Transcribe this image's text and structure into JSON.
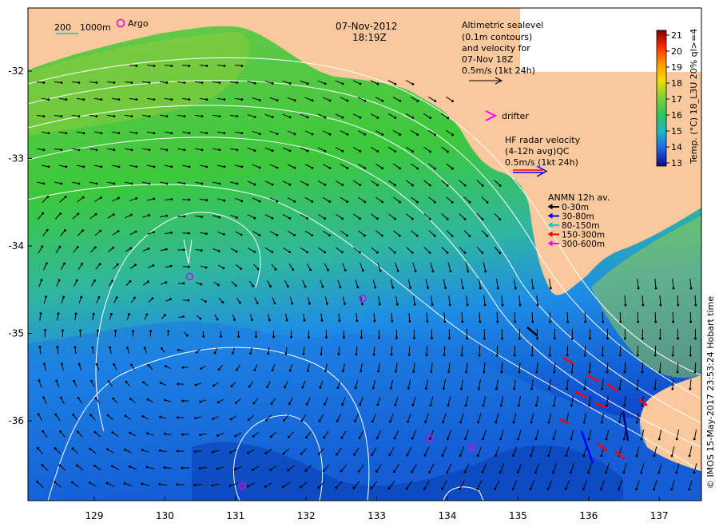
{
  "map": {
    "date": "07-Nov-2012",
    "time": "18:19Z",
    "scale_bar": {
      "label_a": "200",
      "label_b": "1000m"
    },
    "argo_legend": "Argo",
    "altimetry_legend": {
      "lines": [
        "Altimetric sealevel",
        "(0.1m contours)",
        "and velocity for",
        "07-Nov 18Z",
        "0.5m/s (1kt 24h)"
      ]
    },
    "drifter_legend": "drifter",
    "hf_radar_legend": {
      "lines": [
        "HF radar velocity",
        "(4-12h avg)QC",
        "0.5m/s (1kt 24h)"
      ]
    },
    "anmn_legend": {
      "title": "ANMN 12h av.",
      "items": [
        {
          "label": "0-30m",
          "color": "#000000"
        },
        {
          "label": "30-80m",
          "color": "#0000ff"
        },
        {
          "label": "80-150m",
          "color": "#00cccc"
        },
        {
          "label": "150-300m",
          "color": "#ff0000"
        },
        {
          "label": "300-600m",
          "color": "#ff00ff"
        }
      ]
    },
    "colorbar": {
      "ticks": [
        "21",
        "20",
        "19",
        "18",
        "17",
        "16",
        "15",
        "14",
        "13"
      ],
      "label": "Temp. (°C) 18_L3U 20% ql>=4"
    },
    "credit": "© IMOS 15-May-2017 23:53:24 Hobart time",
    "x_ticks": [
      "129",
      "130",
      "131",
      "132",
      "133",
      "134",
      "135",
      "136",
      "137"
    ],
    "y_ticks": [
      "-32",
      "-33",
      "-34",
      "-35",
      "-36"
    ],
    "argo_floats": [
      {
        "lon": 130.35,
        "lat": -34.35
      },
      {
        "lon": 132.8,
        "lat": -34.6
      },
      {
        "lon": 133.75,
        "lat": -36.2
      },
      {
        "lon": 134.35,
        "lat": -36.3
      },
      {
        "lon": 131.1,
        "lat": -36.75
      }
    ],
    "colors": {
      "land": "#f9c99d",
      "ocean_warm": "#3cc83c",
      "ocean_cool": "#1e8ce6",
      "argo": "#e000e0",
      "drifter": "#ff00ff"
    }
  }
}
